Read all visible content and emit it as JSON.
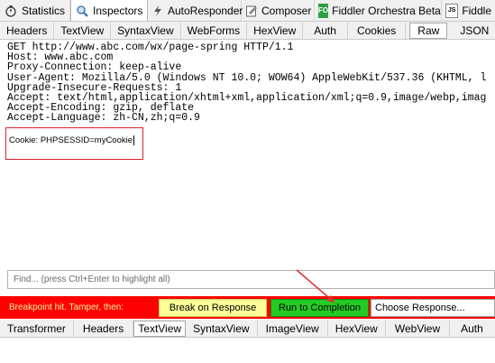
{
  "top_tabs": [
    {
      "label": "Statistics",
      "icon": "stopwatch-icon"
    },
    {
      "label": "Inspectors",
      "icon": "magnifier-icon"
    },
    {
      "label": "AutoResponder",
      "icon": "lightning-icon"
    },
    {
      "label": "Composer",
      "icon": "pencil-icon"
    },
    {
      "label": "Fiddler Orchestra Beta",
      "icon": "fo-icon",
      "icon_text": "FO"
    },
    {
      "label": "Fiddle",
      "icon": "js-icon",
      "icon_text": "JS"
    }
  ],
  "request_tabs": [
    "Headers",
    "TextView",
    "SyntaxView",
    "WebForms",
    "HexView",
    "Auth",
    "Cookies",
    "Raw",
    "JSON"
  ],
  "request_active_tab": "Raw",
  "raw_lines": [
    "GET http://www.abc.com/wx/page-spring HTTP/1.1",
    "Host: www.abc.com",
    "Proxy-Connection: keep-alive",
    "User-Agent: Mozilla/5.0 (Windows NT 10.0; WOW64) AppleWebKit/537.36 (KHTML, l",
    "Upgrade-Insecure-Requests: 1",
    "Accept: text/html,application/xhtml+xml,application/xml;q=0.9,image/webp,imag",
    "Accept-Encoding: gzip, deflate",
    "Accept-Language: zh-CN,zh;q=0.9"
  ],
  "cookie_line": "Cookie: PHPSESSID=myCookie",
  "find_placeholder": "Find... (press Ctrl+Enter to highlight all)",
  "breakpoint": {
    "label": "Breakpoint hit. Tamper, then:",
    "break_on_response": "Break on Response",
    "run_to_completion": "Run to Completion",
    "choose_response": "Choose Response..."
  },
  "response_tabs": [
    "Transformer",
    "Headers",
    "TextView",
    "SyntaxView",
    "ImageView",
    "HexView",
    "WebView",
    "Auth"
  ],
  "response_active_tab": "TextView",
  "colors": {
    "breakpoint_bar": "#ff0000",
    "run_button": "#22cc22",
    "break_button": "#ffff99",
    "highlight_box": "#d9262c"
  }
}
